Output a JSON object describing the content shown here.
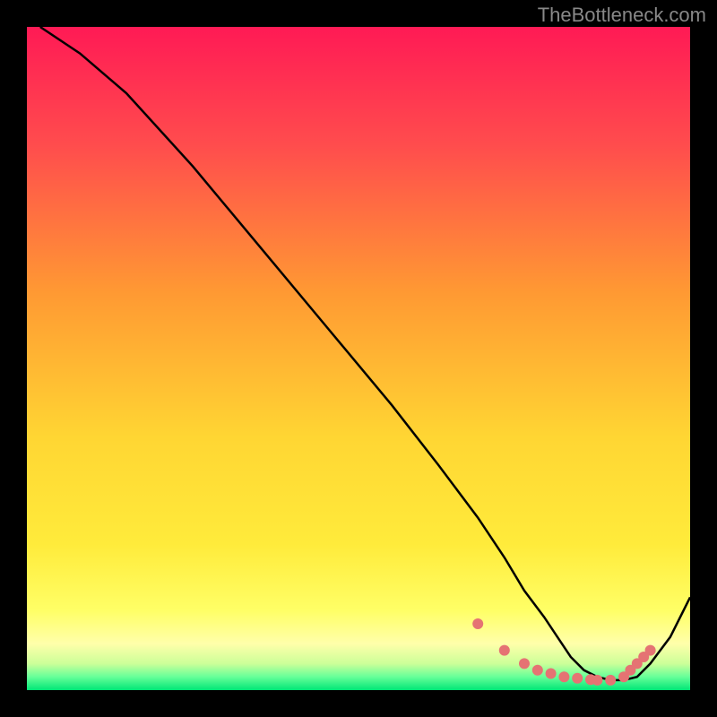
{
  "watermark": "TheBottleneck.com",
  "chart_data": {
    "type": "line",
    "title": "",
    "xlabel": "",
    "ylabel": "",
    "xlim": [
      0,
      100
    ],
    "ylim": [
      0,
      100
    ],
    "gradient_colors": {
      "top": "#ff1744",
      "upper_mid": "#ff9100",
      "mid": "#ffeb3b",
      "lower_mid": "#ffff8d",
      "bottom": "#00e676"
    },
    "series": [
      {
        "name": "curve",
        "color": "#000000",
        "x": [
          2,
          8,
          15,
          25,
          35,
          45,
          55,
          62,
          68,
          72,
          75,
          78,
          80,
          82,
          84,
          86,
          88,
          90,
          92,
          94,
          97,
          100
        ],
        "y": [
          100,
          96,
          90,
          79,
          67,
          55,
          43,
          34,
          26,
          20,
          15,
          11,
          8,
          5,
          3,
          2,
          1.5,
          1.5,
          2,
          4,
          8,
          14
        ]
      }
    ],
    "markers": {
      "name": "highlighted-dots",
      "color": "#e57373",
      "x": [
        68,
        72,
        75,
        77,
        79,
        81,
        83,
        85,
        86,
        88,
        90,
        91,
        92,
        93,
        94
      ],
      "y": [
        10,
        6,
        4,
        3,
        2.5,
        2,
        1.8,
        1.6,
        1.5,
        1.5,
        2,
        3,
        4,
        5,
        6
      ]
    }
  }
}
